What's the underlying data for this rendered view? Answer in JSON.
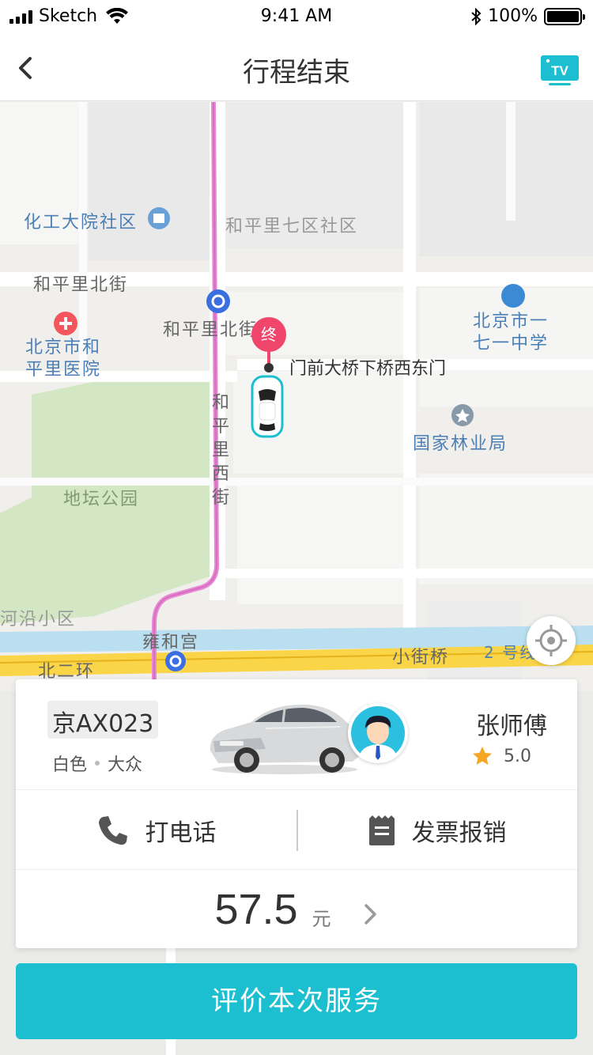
{
  "status_bar": {
    "carrier": "Sketch",
    "time": "9:41 AM",
    "battery": "100%"
  },
  "nav": {
    "title": "行程结束",
    "back_icon": "chevron-left-icon",
    "tv_icon": "tv-icon",
    "tv_label": "TV"
  },
  "map": {
    "labels": {
      "chemical": "化工大院社区",
      "heping7": "和平里七区社区",
      "hepingbei": "和平里北街",
      "hepingbei2": "和平里北街",
      "hospital": "北京市和平里医院",
      "school": "北京市一七一中学",
      "forestry": "国家林业局",
      "ditan": "地坛公园",
      "hepingxi": "和平里西街",
      "hheyan": "河沿小区",
      "yonghegong": "雍和宫",
      "beierhuan": "北二环",
      "xiaojieqiao": "小街桥",
      "line2": "2 号线",
      "destination": "门前大桥下桥西东门"
    },
    "end_marker": "终"
  },
  "card": {
    "plate": "京AX023",
    "car_color": "白色",
    "car_brand": "大众",
    "driver_name": "张师傅",
    "rating": "5.0",
    "call_label": "打电话",
    "invoice_label": "发票报销",
    "price": "57.5",
    "price_unit": "元"
  },
  "cta_label": "评价本次服务",
  "colors": {
    "accent": "#1bbfcf",
    "end_marker": "#f0466b",
    "star": "#f5a623"
  }
}
